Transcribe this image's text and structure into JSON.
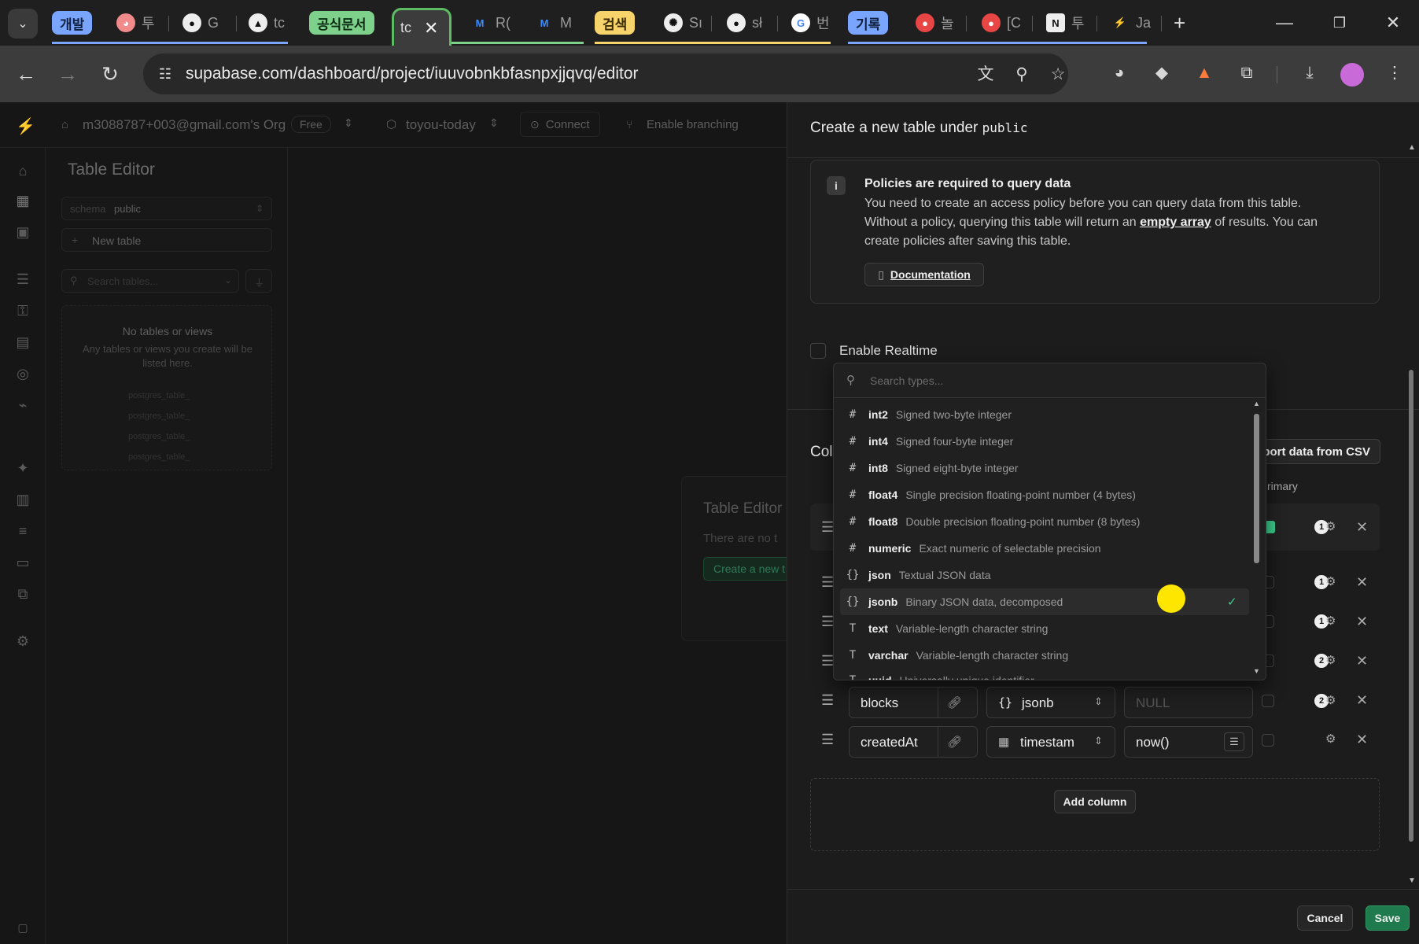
{
  "browser": {
    "tabs": [
      {
        "group": "개발",
        "groupColor": "#7aa5ff"
      },
      {
        "title": "투"
      },
      {
        "title": "G"
      },
      {
        "title": "tc"
      },
      {
        "group": "공식문서",
        "groupColor": "#7ed18a"
      },
      {
        "title": "tc",
        "active": true
      },
      {
        "title": "R("
      },
      {
        "title": "M"
      },
      {
        "group": "검색",
        "groupColor": "#f7d36b"
      },
      {
        "title": "Sı"
      },
      {
        "title": "sł"
      },
      {
        "title": "번"
      },
      {
        "group": "기록",
        "groupColor": "#7aa5ff"
      },
      {
        "title": "놀"
      },
      {
        "title": "[C"
      },
      {
        "title": "투"
      },
      {
        "title": "Ja"
      }
    ],
    "url": "supabase.com/dashboard/project/iuuvobnkbfasnpxjjqvq/editor",
    "close_symbol": "✕",
    "new_tab_symbol": "+"
  },
  "dashboard": {
    "org": "m3088787+003@gmail.com's Org",
    "plan_badge": "Free",
    "project": "toyou-today",
    "connect": "Connect",
    "branching": "Enable branching",
    "section_title": "Table Editor",
    "schema_label": "schema",
    "schema_value": "public",
    "new_table": "New table",
    "search_placeholder": "Search tables...",
    "empty_title": "No tables or views",
    "empty_desc": "Any tables or views you create will be listed here.",
    "ghost_tables": [
      "postgres_table_",
      "postgres_table_",
      "postgres_table_",
      "postgres_table_"
    ],
    "center_title": "Table Editor",
    "center_desc": "There are no t",
    "center_button": "Create a new t"
  },
  "panel": {
    "title_prefix": "Create a new table under",
    "title_schema": "public",
    "policy_title": "Policies are required to query data",
    "policy_line1": "You need to create an access policy before you can query data from this table.",
    "policy_line2_a": "Without a policy, querying this table will return an ",
    "policy_link": "empty array",
    "policy_line2_b": " of results. You can",
    "policy_line3": "create policies after saving this table.",
    "docs_button": "Documentation",
    "realtime_label": "Enable Realtime",
    "columns_heading": "Col",
    "import_csv": "nport data from CSV",
    "primary_header": "rimary",
    "rows": [
      {
        "badge": "1"
      },
      {
        "badge": "1"
      },
      {
        "badge": "1"
      },
      {
        "badge": "2"
      },
      {
        "name": "blocks",
        "type": "jsonb",
        "type_icon": "{}",
        "default": "NULL",
        "badge": "2"
      },
      {
        "name": "createdAt",
        "type": "timestam",
        "type_icon": "calendar",
        "default": "now()",
        "badge": ""
      }
    ],
    "add_column": "Add column",
    "cancel": "Cancel",
    "save": "Save"
  },
  "type_dropdown": {
    "search_placeholder": "Search types...",
    "selected": "jsonb",
    "items": [
      {
        "icon": "#",
        "name": "int2",
        "desc": "Signed two-byte integer"
      },
      {
        "icon": "#",
        "name": "int4",
        "desc": "Signed four-byte integer"
      },
      {
        "icon": "#",
        "name": "int8",
        "desc": "Signed eight-byte integer"
      },
      {
        "icon": "#",
        "name": "float4",
        "desc": "Single precision floating-point number (4 bytes)"
      },
      {
        "icon": "#",
        "name": "float8",
        "desc": "Double precision floating-point number (8 bytes)"
      },
      {
        "icon": "#",
        "name": "numeric",
        "desc": "Exact numeric of selectable precision"
      },
      {
        "icon": "{}",
        "name": "json",
        "desc": "Textual JSON data"
      },
      {
        "icon": "{}",
        "name": "jsonb",
        "desc": "Binary JSON data, decomposed"
      },
      {
        "icon": "T",
        "name": "text",
        "desc": "Variable-length character string"
      },
      {
        "icon": "T",
        "name": "varchar",
        "desc": "Variable-length character string"
      },
      {
        "icon": "T",
        "name": "uuid",
        "desc": "Universally unique identifier"
      }
    ]
  },
  "colors": {
    "accent_green": "#3ecf8e",
    "save_green": "#1f7a4d",
    "cursor_yellow": "#ffe600"
  }
}
